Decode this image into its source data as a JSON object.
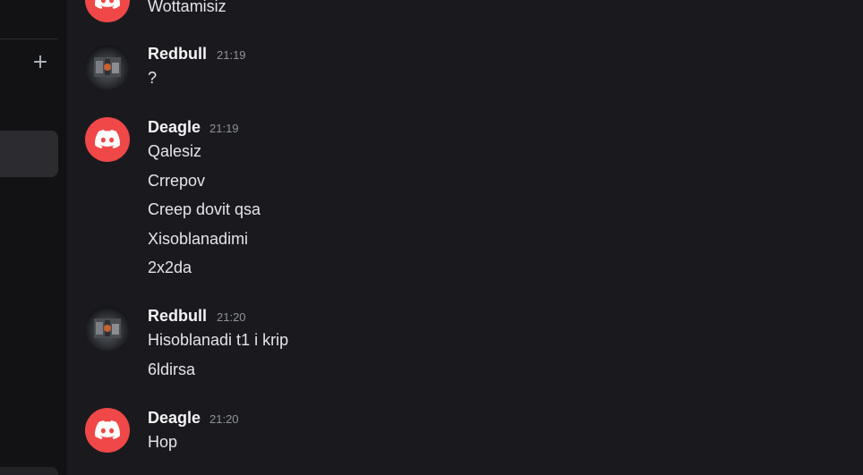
{
  "messages": [
    {
      "author": "",
      "time": "",
      "avatar": "discord-icon",
      "lines": [
        "Wottamisiz"
      ]
    },
    {
      "author": "Redbull",
      "time": "21:19",
      "avatar": "user-photo",
      "lines": [
        "?"
      ]
    },
    {
      "author": "Deagle",
      "time": "21:19",
      "avatar": "discord-icon",
      "lines": [
        "Qalesiz",
        "Crrepov",
        "Creep dovit qsa",
        "Xisoblanadimi",
        "2x2da"
      ]
    },
    {
      "author": "Redbull",
      "time": "21:20",
      "avatar": "user-photo",
      "lines": [
        "Hisoblanadi t1 i krip",
        "6ldirsa"
      ]
    },
    {
      "author": "Deagle",
      "time": "21:20",
      "avatar": "discord-icon",
      "lines": [
        "Hop"
      ]
    }
  ],
  "sidebar": {
    "add_icon": "plus-icon"
  },
  "colors": {
    "background": "#1a1a1e",
    "sidebar": "#121214",
    "discord_avatar": "#f04848"
  }
}
